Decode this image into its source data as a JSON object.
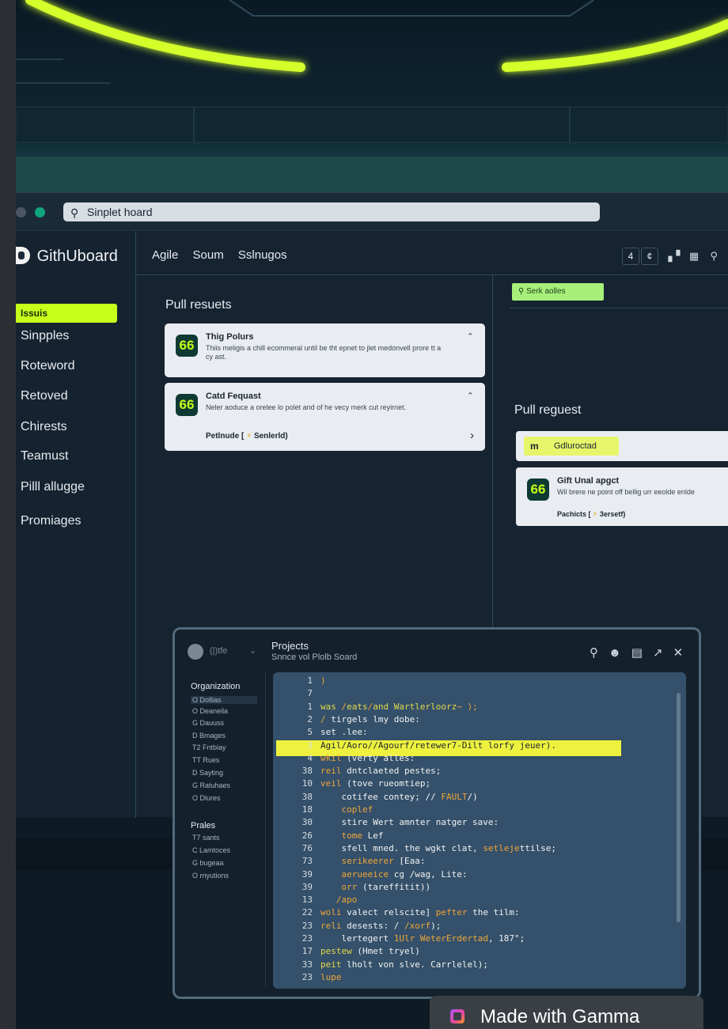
{
  "browser": {
    "search_text": "Sinplet hoard"
  },
  "app": {
    "logo_text": "GithUboard"
  },
  "sidebar": {
    "items": [
      {
        "label": "Issuis",
        "active": true
      },
      {
        "label": "Sinpples"
      },
      {
        "label": "Roteword"
      },
      {
        "label": "Retoved"
      },
      {
        "label": "Chirests"
      },
      {
        "label": "Teamust"
      },
      {
        "label": "Pilll allugge"
      },
      {
        "label": "Promiages"
      }
    ]
  },
  "topnav": {
    "items": [
      "Agile",
      "Soum",
      "Sslnugos"
    ]
  },
  "top_controls": {
    "count_a": "4",
    "count_b": "¢"
  },
  "left_panel": {
    "title": "Pull resuets",
    "cards": [
      {
        "avatar": "66",
        "title": "Thig Polurs",
        "body": "Thiis meligis a chill ecommeral until be tht epnet to jlet medonvell prore tt a cy ast."
      },
      {
        "avatar": "66",
        "title": "Catd Fequast",
        "body": "Neler aoduce a orelee lo polet and of he vecy merk cut reyirnet.",
        "meta_prefix": "Petlnude [",
        "meta_suffix": "Senlerld)"
      }
    ]
  },
  "right_panel": {
    "filter_label": "Serk aolles",
    "title": "Pull reguest",
    "gold_tag": {
      "marker": "m",
      "label": "Gdluroctad"
    },
    "card": {
      "avatar": "66",
      "title": "Gift Unal apgct",
      "body": "Wil brere ne point off bellig urr eeolde enlde",
      "meta_prefix": "Pachicts [",
      "meta_suffix": "3ersetf)"
    }
  },
  "editor": {
    "head_label": "(|)tfe",
    "title": "Projects",
    "subtitle": "Snnce vol Plolb Soard",
    "groups": [
      {
        "label": "Organization",
        "items": [
          "O Dollias",
          "O Deaneila",
          "G Dauuss",
          "D Bmages",
          "T2 Fntbiay",
          "TT Rues",
          "D Sayting",
          "G Ratuhaes",
          "O Dlures"
        ]
      },
      {
        "label": "Prales",
        "items": [
          "T7 sants",
          "C Lamtoces",
          "G bugeaa",
          "O rnyutions"
        ]
      }
    ],
    "code_lines": [
      {
        "num": "1",
        "segments": [
          {
            "text": ")",
            "cls": "o"
          }
        ]
      },
      {
        "num": "7",
        "segments": [
          {
            "text": ""
          }
        ]
      },
      {
        "num": "1",
        "segments": [
          {
            "text": "was ",
            "cls": "k"
          },
          {
            "text": "/",
            "cls": "o"
          },
          {
            "text": "eats",
            "cls": "k"
          },
          {
            "text": "/",
            "cls": "o"
          },
          {
            "text": "and ",
            "cls": "k"
          },
          {
            "text": "Wartlerloorz",
            "cls": "k"
          },
          {
            "text": "~ );",
            "cls": "o"
          }
        ]
      },
      {
        "num": "2",
        "segments": [
          {
            "text": "/ ",
            "cls": "o"
          },
          {
            "text": "tirgels lmy dobe:"
          }
        ]
      },
      {
        "num": "5",
        "segments": [
          {
            "text": "set .lee:"
          }
        ]
      },
      {
        "num": "3",
        "segments": [
          {
            "text": "Agil/Aoro//Agourf/retewer7-Dilt lorfy jeuer)."
          }
        ]
      },
      {
        "num": "4",
        "segments": [
          {
            "text": "wkil ",
            "cls": "o"
          },
          {
            "text": "(verty alles:"
          }
        ]
      },
      {
        "num": "38",
        "segments": [
          {
            "text": "reil ",
            "cls": "o"
          },
          {
            "text": "dntclaeted pestes;"
          }
        ]
      },
      {
        "num": "10",
        "segments": [
          {
            "text": "veil ",
            "cls": "o"
          },
          {
            "text": "(tove rueomtiep;"
          }
        ]
      },
      {
        "num": "38",
        "segments": [
          {
            "text": "    cotifee contey; // ",
            "cls": ""
          },
          {
            "text": "FAULT",
            "cls": "o"
          },
          {
            "text": "/)"
          }
        ]
      },
      {
        "num": "18",
        "segments": [
          {
            "text": "    coplef",
            "cls": "o"
          }
        ]
      },
      {
        "num": "30",
        "segments": [
          {
            "text": "    stire Wert amnter natger save:"
          }
        ]
      },
      {
        "num": "26",
        "segments": [
          {
            "text": "    "
          },
          {
            "text": "tome ",
            "cls": "o"
          },
          {
            "text": "Lef"
          }
        ]
      },
      {
        "num": "76",
        "segments": [
          {
            "text": "    sfell mned. the wgkt clat, "
          },
          {
            "text": "setleje",
            "cls": "o"
          },
          {
            "text": "ttilse;"
          }
        ]
      },
      {
        "num": "73",
        "segments": [
          {
            "text": "    "
          },
          {
            "text": "serikeerer ",
            "cls": "o"
          },
          {
            "text": "[Eaa:"
          }
        ]
      },
      {
        "num": "39",
        "segments": [
          {
            "text": "    "
          },
          {
            "text": "aerueeice ",
            "cls": "o"
          },
          {
            "text": "cg /wag, Lite:"
          }
        ]
      },
      {
        "num": "39",
        "segments": [
          {
            "text": "    "
          },
          {
            "text": "orr ",
            "cls": "o"
          },
          {
            "text": "(tareffitit))"
          }
        ]
      },
      {
        "num": "13",
        "segments": [
          {
            "text": "   /apo",
            "cls": "o"
          }
        ]
      },
      {
        "num": "22",
        "segments": [
          {
            "text": "woli ",
            "cls": "o"
          },
          {
            "text": "valect relscite] "
          },
          {
            "text": "pefter ",
            "cls": "o"
          },
          {
            "text": "the tilm:"
          }
        ]
      },
      {
        "num": "23",
        "segments": [
          {
            "text": "reli ",
            "cls": "o"
          },
          {
            "text": "desests: / "
          },
          {
            "text": "/xorf",
            "cls": "o"
          },
          {
            "text": ");"
          }
        ]
      },
      {
        "num": "23",
        "segments": [
          {
            "text": "    lertegert "
          },
          {
            "text": "1Ulr ",
            "cls": "o"
          },
          {
            "text": "WeterErdertad",
            "cls": "o"
          },
          {
            "text": ", 187°;"
          }
        ]
      },
      {
        "num": "17",
        "segments": [
          {
            "text": "pestew ",
            "cls": "k"
          },
          {
            "text": "(Hmet tryel)"
          }
        ]
      },
      {
        "num": "33",
        "segments": [
          {
            "text": "peit ",
            "cls": "k"
          },
          {
            "text": "lholt von slve. Carrlelel);"
          }
        ]
      },
      {
        "num": "23",
        "segments": [
          {
            "text": "lupe",
            "cls": "o"
          }
        ]
      }
    ]
  },
  "badge": {
    "label": "Made with Gamma"
  }
}
